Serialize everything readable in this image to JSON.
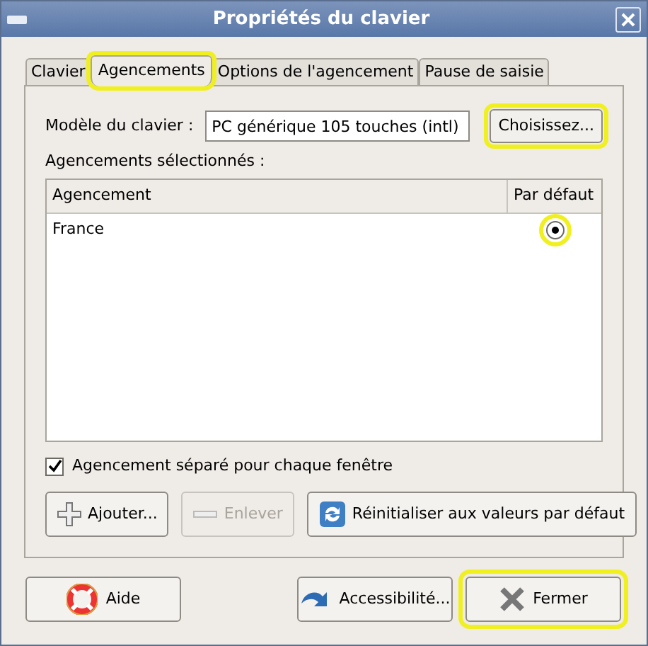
{
  "window": {
    "title": "Propriétés du clavier"
  },
  "tabs": [
    {
      "label": "Clavier",
      "selected": false,
      "highlighted": false
    },
    {
      "label": "Agencements",
      "selected": true,
      "highlighted": true
    },
    {
      "label": "Options de l'agencement",
      "selected": false,
      "highlighted": false
    },
    {
      "label": "Pause de saisie",
      "selected": false,
      "highlighted": false
    }
  ],
  "model": {
    "label": "Modèle du clavier :",
    "value": "PC générique 105 touches (intl)",
    "button": {
      "label": "Choisissez...",
      "highlighted": true
    }
  },
  "layouts": {
    "label": "Agencements sélectionnés :",
    "columns": [
      "Agencement",
      "Par défaut"
    ],
    "rows": [
      {
        "name": "France",
        "selected": true,
        "highlighted": true
      }
    ]
  },
  "separate": {
    "label": "Agencement séparé pour chaque fenêtre",
    "checked": true
  },
  "actions": [
    {
      "kind": "add",
      "label": "Ajouter...",
      "disabled": false
    },
    {
      "kind": "remove",
      "label": "Enlever",
      "disabled": true
    },
    {
      "kind": "reset",
      "label": "Réinitialiser aux valeurs par défaut",
      "disabled": false
    }
  ],
  "footer": [
    {
      "kind": "help",
      "label": "Aide",
      "highlighted": false
    },
    {
      "kind": "accessibility",
      "label": "Accessibilité...",
      "highlighted": false
    },
    {
      "kind": "close",
      "label": "Fermer",
      "highlighted": true
    }
  ]
}
